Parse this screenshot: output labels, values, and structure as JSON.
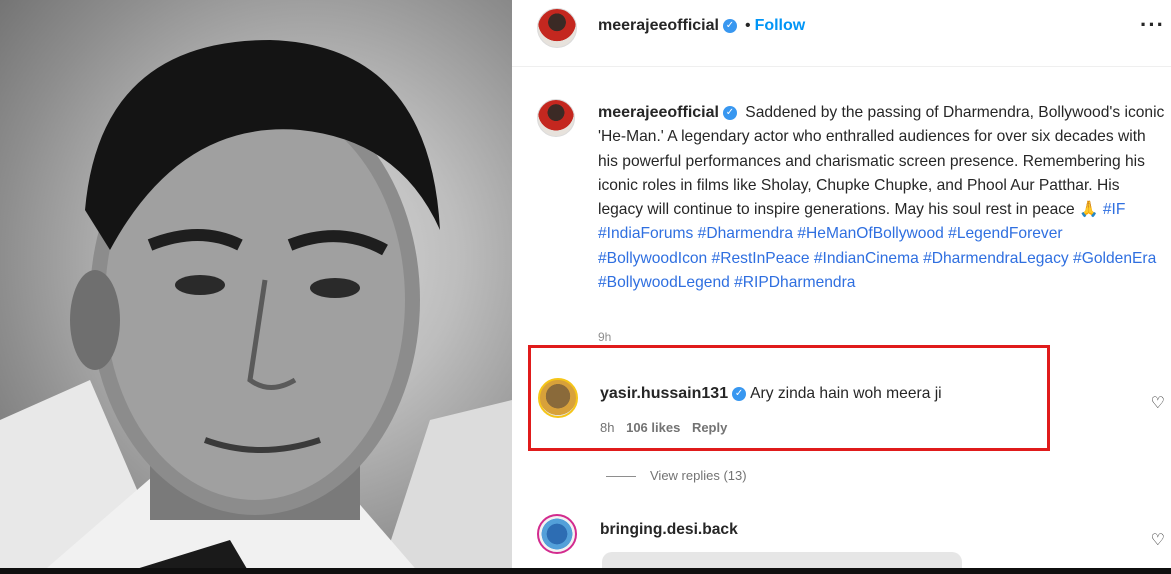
{
  "header": {
    "username": "meerajeeofficial",
    "separator": "•",
    "follow_label": "Follow",
    "more_label": "···"
  },
  "caption": {
    "username": "meerajeeofficial",
    "text": "Saddened by the passing of Dharmendra, Bollywood's iconic 'He-Man.' A legendary actor who enthralled audiences for over six decades with his powerful performances and charismatic screen presence. Remembering his iconic roles in films like Sholay, Chupke Chupke, and Phool Aur Patthar. His legacy will continue to inspire generations. May his soul rest in peace 🙏",
    "hashtags": "#IF #IndiaForums #Dharmendra #HeManOfBollywood #LegendForever #BollywoodIcon #RestInPeace #IndianCinema #DharmendraLegacy #GoldenEra #BollywoodLegend #RIPDharmendra",
    "time": "9h"
  },
  "comments": [
    {
      "username": "yasir.hussain131",
      "text": "Ary zinda hain woh meera ji",
      "time": "8h",
      "likes": "106 likes",
      "reply_label": "Reply",
      "view_replies": "View replies (13)"
    },
    {
      "username": "bringing.desi.back"
    }
  ],
  "icons": {
    "verified": "verified-badge-icon",
    "heart": "heart-icon",
    "more": "more-options-icon"
  },
  "colors": {
    "accent": "#0095f6",
    "hashtag": "#2f6fe0",
    "highlight": "#e01b1b"
  }
}
